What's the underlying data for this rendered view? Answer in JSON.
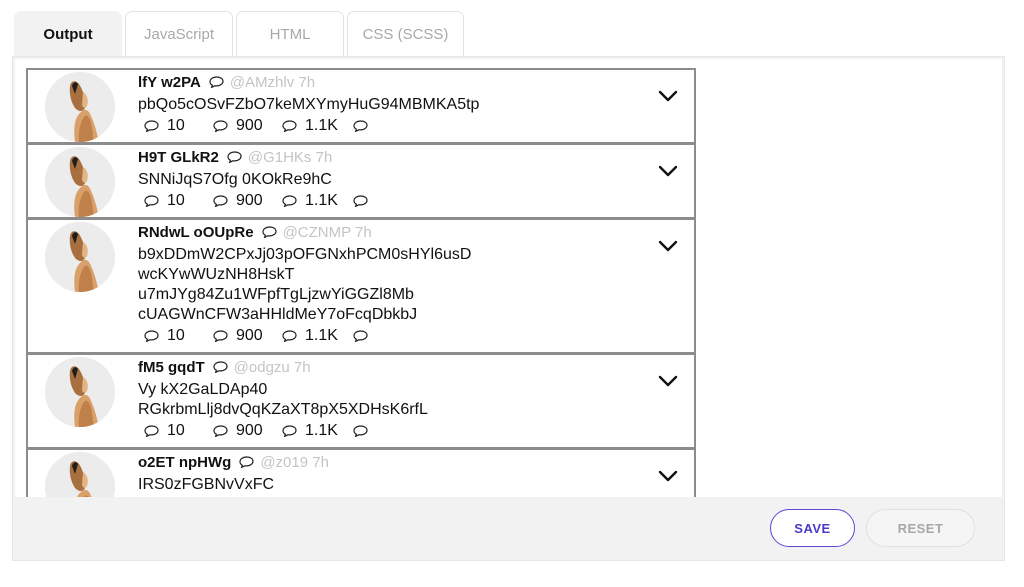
{
  "tabs": [
    {
      "label": "Output",
      "active": true
    },
    {
      "label": "JavaScript",
      "active": false
    },
    {
      "label": "HTML",
      "active": false
    },
    {
      "label": "CSS (SCSS)",
      "active": false
    }
  ],
  "tweets": [
    {
      "name": "lfY w2PA",
      "handle": "@AMzhlv 7h",
      "lines": [
        "pbQo5cOSvFZbO7keMXYmyHuG94MBMKA5tp"
      ],
      "replies": "10",
      "retweets": "900",
      "likes": "1.1K"
    },
    {
      "name": "H9T GLkR2",
      "handle": "@G1HKs 7h",
      "lines": [
        "SNNiJqS7Ofg 0KOkRe9hC"
      ],
      "replies": "10",
      "retweets": "900",
      "likes": "1.1K"
    },
    {
      "name": "RNdwL oOUpRe",
      "handle": "@CZNMP 7h",
      "lines": [
        "b9xDDmW2CPxJj03pOFGNxhPCM0sHYl6usD",
        "wcKYwWUzNH8HskT",
        "u7mJYg84Zu1WFpfTgLjzwYiGGZl8Mb",
        "cUAGWnCFW3aHHldMeY7oFcqDbkbJ"
      ],
      "replies": "10",
      "retweets": "900",
      "likes": "1.1K"
    },
    {
      "name": "fM5 gqdT",
      "handle": "@odgzu 7h",
      "lines": [
        "Vy kX2GaLDAp40",
        "RGkrbmLlj8dvQqKZaXT8pX5XDHsK6rfL"
      ],
      "replies": "10",
      "retweets": "900",
      "likes": "1.1K"
    },
    {
      "name": "o2ET npHWg",
      "handle": "@z019 7h",
      "lines": [
        "IRS0zFGBNvVxFC"
      ],
      "replies": "",
      "retweets": "",
      "likes": ""
    }
  ],
  "icons": {
    "bubble": "comment-bubble-icon",
    "chevron": "chevron-down-icon",
    "avatar": "dog-avatar-image"
  },
  "buttons": {
    "save": "SAVE",
    "reset": "RESET"
  },
  "colors": {
    "accent": "#4a3cc9",
    "handle": "#c4c4c4",
    "border": "#8c8c8c"
  }
}
